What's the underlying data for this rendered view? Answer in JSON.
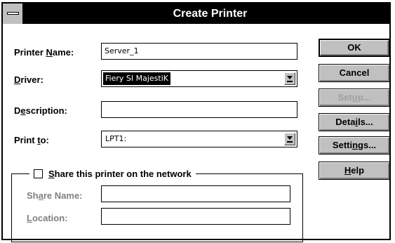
{
  "window": {
    "title": "Create Printer"
  },
  "form": {
    "printer_name": {
      "label_pre": "Printer ",
      "label_key": "N",
      "label_post": "ame:",
      "value": "Server_1"
    },
    "driver": {
      "label_pre": "",
      "label_key": "D",
      "label_post": "river:",
      "value": "Fiery SI MajestiK"
    },
    "description": {
      "label_pre": "D",
      "label_key": "e",
      "label_post": "scription:",
      "value": ""
    },
    "print_to": {
      "label_pre": "Print ",
      "label_key": "t",
      "label_post": "o:",
      "value": "LPT1:"
    }
  },
  "share": {
    "checkbox_label_key": "S",
    "checkbox_label_post": "hare this printer on the network",
    "checked": false,
    "share_name": {
      "label_pre": "Sh",
      "label_key": "a",
      "label_post": "re Name:",
      "value": ""
    },
    "location": {
      "label_pre": "",
      "label_key": "L",
      "label_post": "ocation:",
      "value": ""
    }
  },
  "buttons": {
    "ok": {
      "label_pre": "OK",
      "label_key": "",
      "label_post": ""
    },
    "cancel": {
      "label_pre": "Cancel",
      "label_key": "",
      "label_post": ""
    },
    "setup": {
      "label_pre": "Set",
      "label_key": "u",
      "label_post": "p..."
    },
    "details": {
      "label_pre": "Deta",
      "label_key": "i",
      "label_post": "ls..."
    },
    "settings": {
      "label_pre": "Setti",
      "label_key": "n",
      "label_post": "gs..."
    },
    "help": {
      "label_pre": "",
      "label_key": "H",
      "label_post": "elp"
    }
  },
  "icons": {
    "system_menu": "system-menu-icon",
    "dropdown_arrow": "dropdown-arrow-icon"
  },
  "colors": {
    "titlebar": "#000000",
    "button_face": "#c0c0c0",
    "disabled_text": "#808080"
  }
}
